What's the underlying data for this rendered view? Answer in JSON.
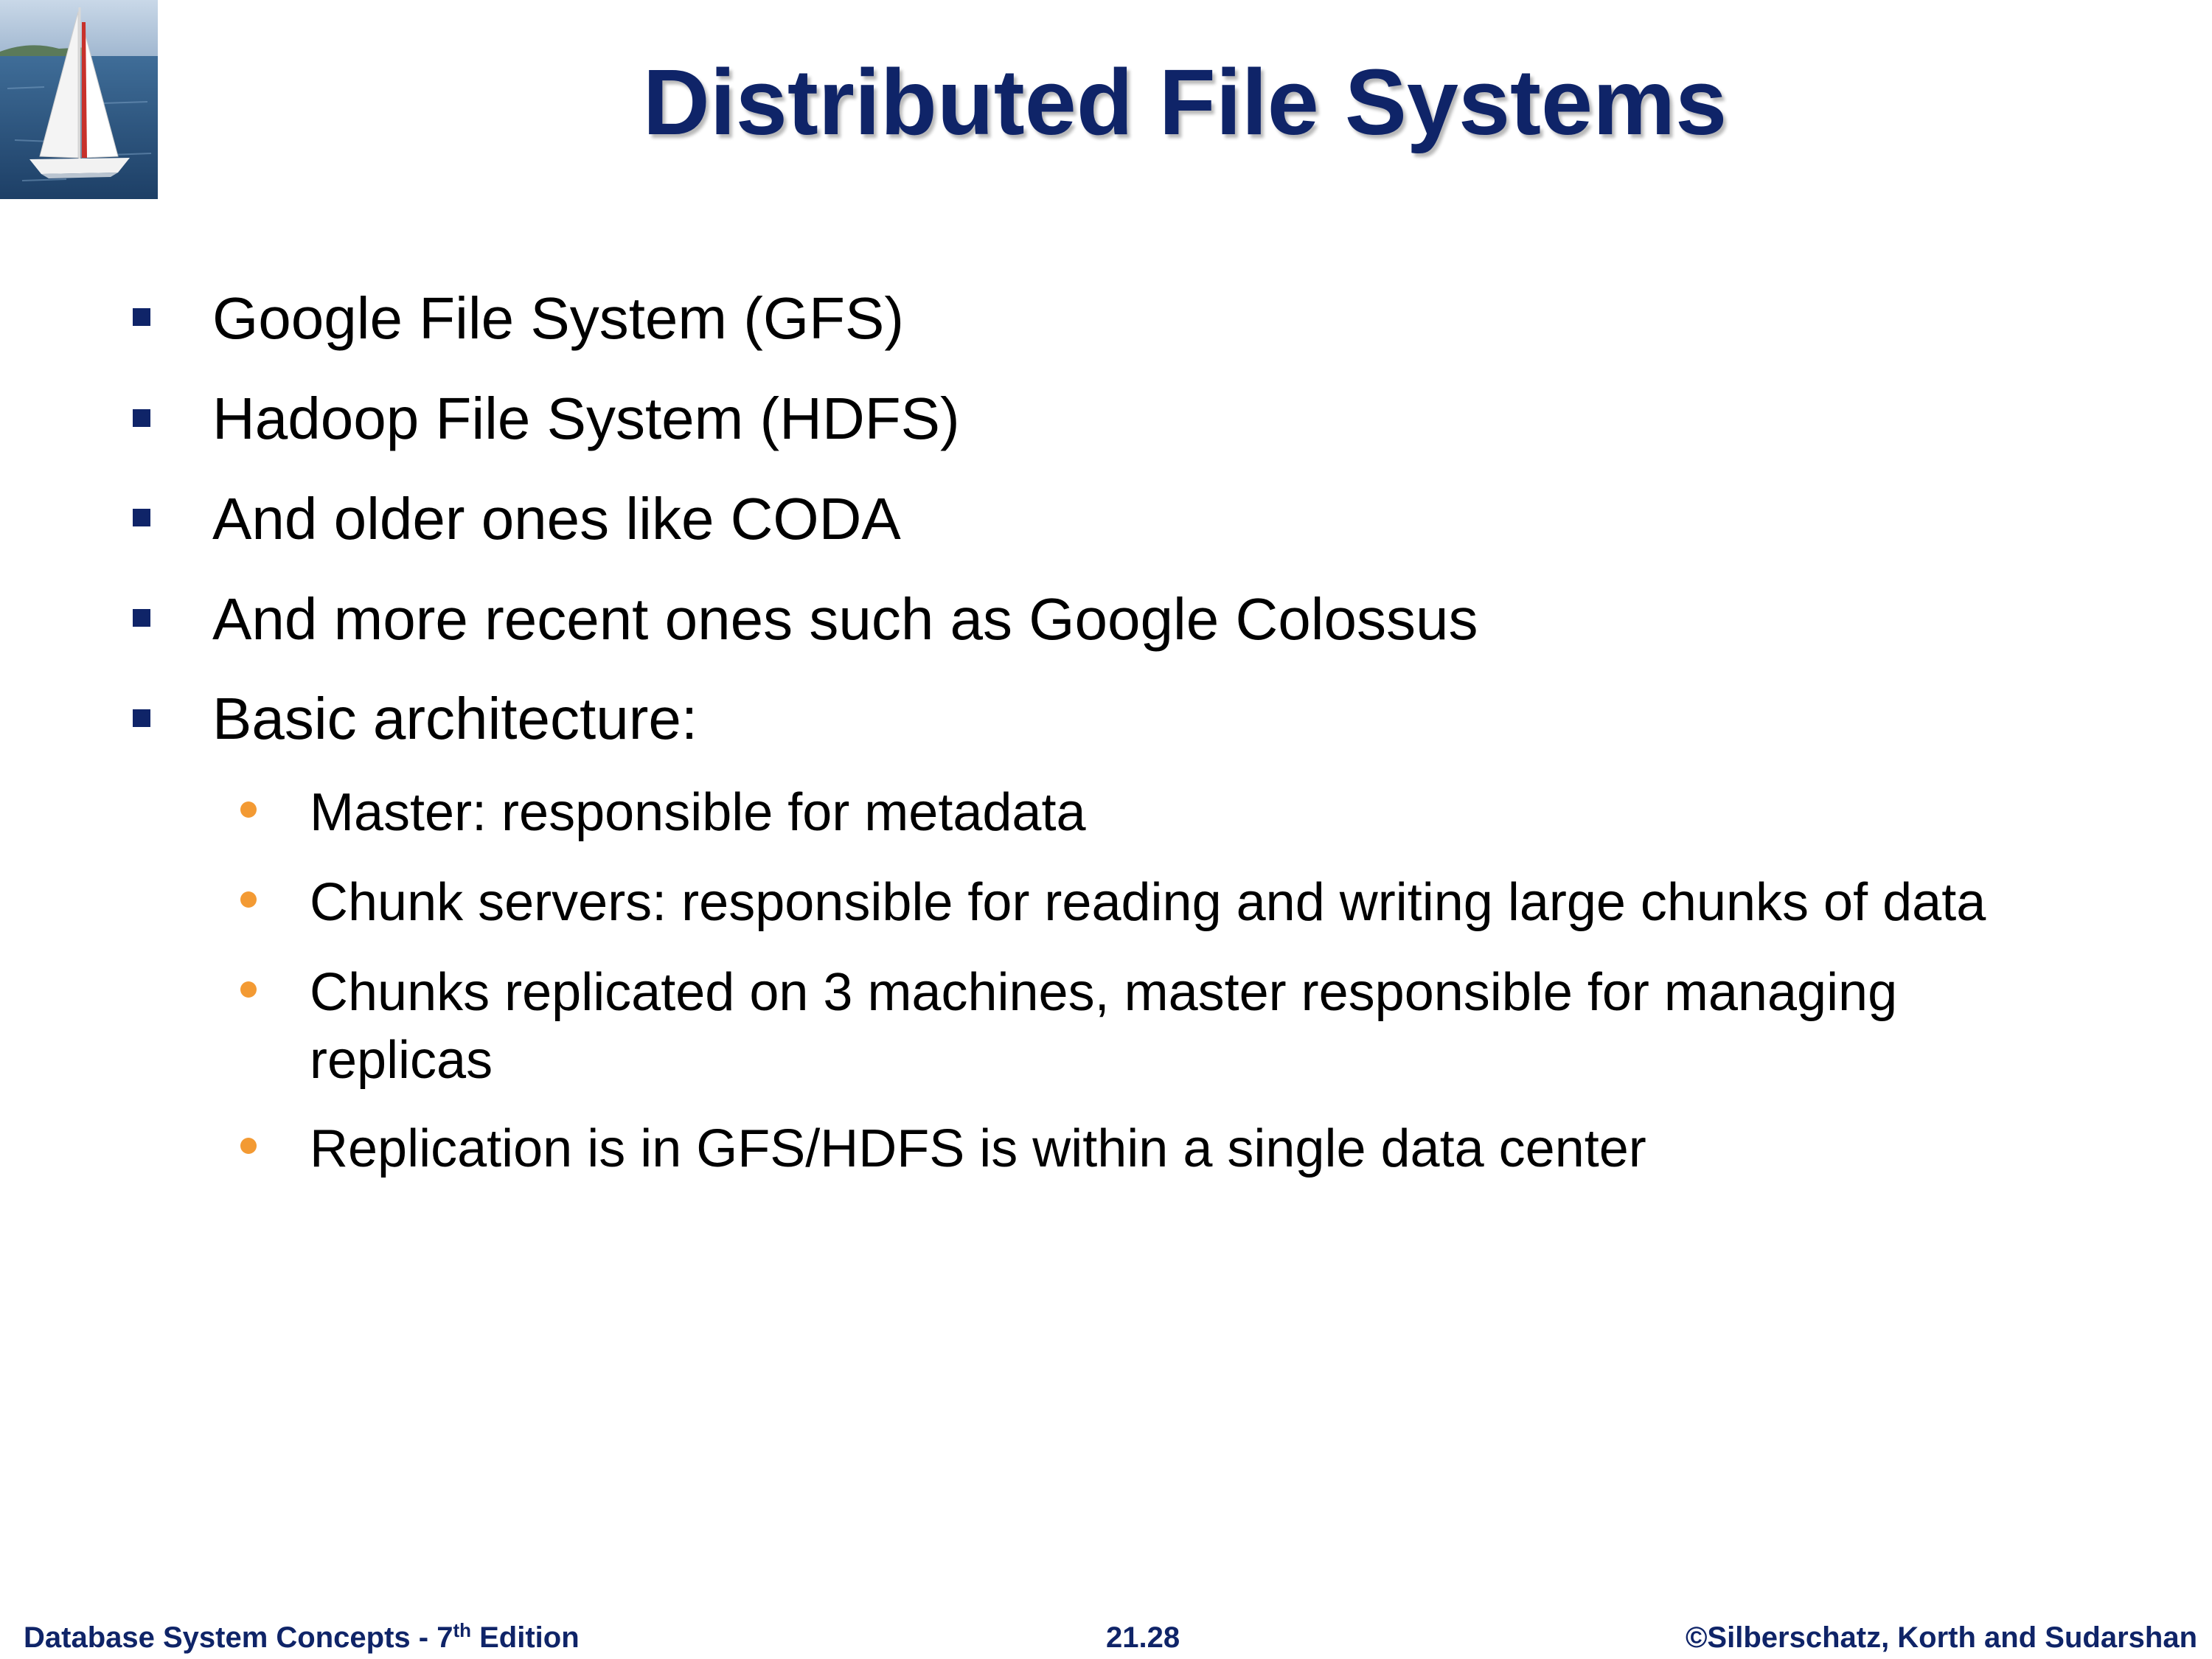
{
  "slide": {
    "title": "Distributed File Systems",
    "bullets": [
      "Google File System (GFS)",
      "Hadoop File System (HDFS)",
      "And older ones like CODA",
      "And more recent ones such as Google Colossus",
      "Basic architecture:"
    ],
    "sub_bullets": [
      "Master: responsible for metadata",
      "Chunk servers: responsible for reading and writing large chunks of data",
      "Chunks replicated on 3 machines, master responsible for managing",
      "replicas",
      "Replication is in GFS/HDFS is within a single data center"
    ]
  },
  "footer": {
    "left_prefix": "Database System Concepts - 7",
    "left_sup": "th",
    "left_suffix": " Edition",
    "center": "21.28",
    "right": "©Silberschatz, Korth and Sudarshan"
  },
  "colors": {
    "title": "#0f2468",
    "primary_bullet": "#0f2468",
    "secondary_bullet": "#f39a33",
    "footer_text": "#0f2468"
  },
  "icons": {
    "logo": "sailboat-logo-icon",
    "primary_bullet": "square-bullet-icon",
    "secondary_bullet": "dot-bullet-icon"
  }
}
